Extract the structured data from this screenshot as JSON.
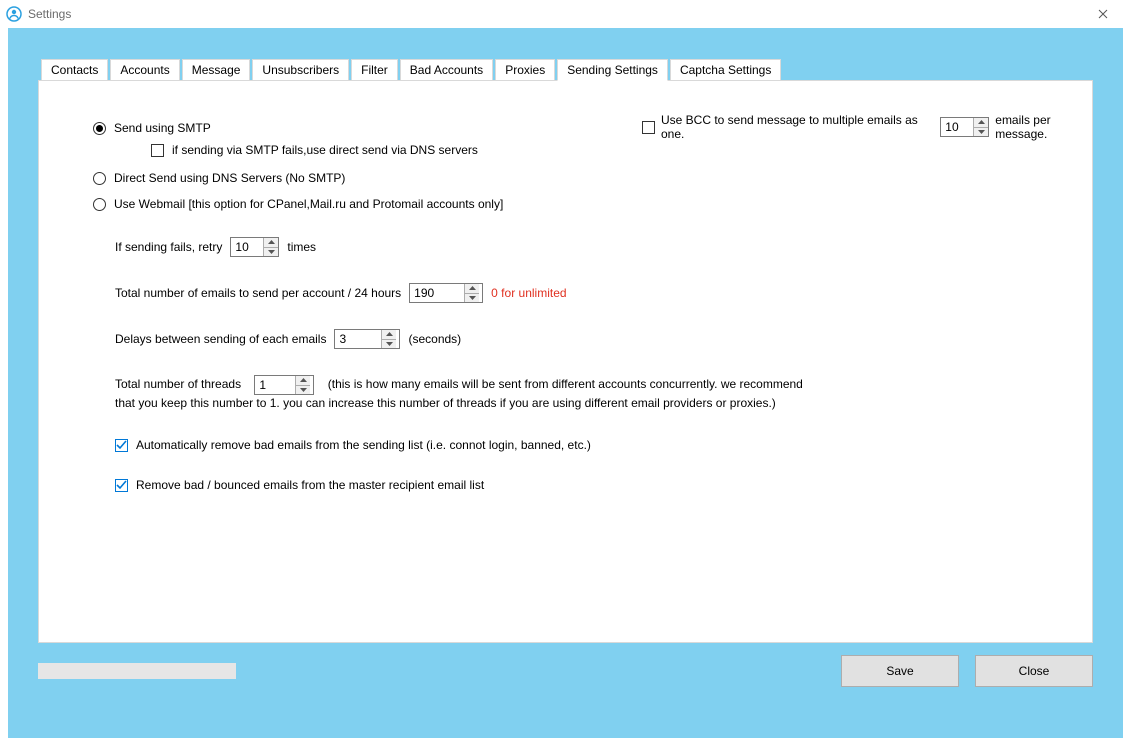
{
  "window": {
    "title": "Settings"
  },
  "tabs": {
    "contacts": "Contacts",
    "accounts": "Accounts",
    "message": "Message",
    "unsubscribers": "Unsubscribers",
    "filter": "Filter",
    "bad_accounts": "Bad Accounts",
    "proxies": "Proxies",
    "sending_settings": "Sending Settings",
    "captcha_settings": "Captcha Settings"
  },
  "sending": {
    "radio_smtp": "Send using SMTP",
    "chk_dns_fallback": "if sending via SMTP fails,use direct send via DNS servers",
    "radio_direct": "Direct Send using DNS Servers (No SMTP)",
    "radio_webmail": "Use Webmail [this option for CPanel,Mail.ru and Protomail accounts only]",
    "retry_label_pre": "If sending fails, retry",
    "retry_value": "10",
    "retry_label_post": "times",
    "per_account_label": "Total number of emails to send per account / 24 hours",
    "per_account_value": "190",
    "per_account_hint": "0 for unlimited",
    "delay_label": "Delays between sending of each emails",
    "delay_value": "3",
    "delay_unit": "(seconds)",
    "threads_label": "Total number of threads",
    "threads_value": "1",
    "threads_hint": "(this is how many emails will be sent from different accounts concurrently. we recommend that you keep this number to 1. you can increase this number of threads if you are using different email providers or proxies.)",
    "chk_auto_remove": "Automatically remove bad emails from the sending list (i.e. connot login, banned, etc.)",
    "chk_remove_bounced": "Remove bad / bounced emails from the master recipient email list",
    "bcc_label": "Use BCC to send message to multiple emails as one.",
    "bcc_value": "10",
    "bcc_suffix": "emails per message."
  },
  "buttons": {
    "save": "Save",
    "close": "Close"
  }
}
